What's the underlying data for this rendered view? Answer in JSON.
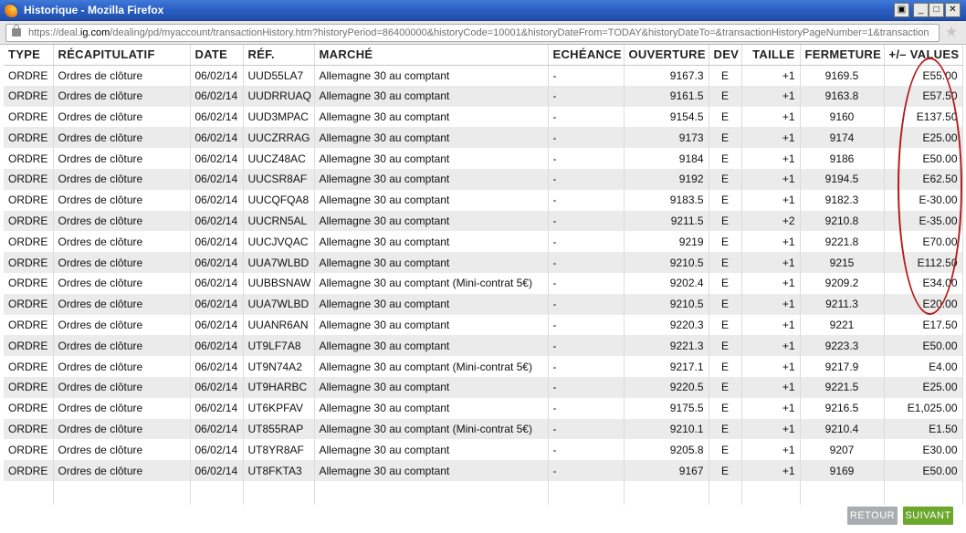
{
  "window": {
    "title": "Historique - Mozilla Firefox",
    "url_host_prefix": "https://deal.",
    "url_host_domain": "ig.com",
    "url_path": "/dealing/pd/myaccount/transactionHistory.htm?historyPeriod=86400000&historyCode=10001&historyDateFrom=TODAY&historyDateTo=&transactionHistoryPageNumber=1&transaction"
  },
  "table": {
    "headers": [
      "TYPE",
      "RÉCAPITULATIF",
      "DATE",
      "RÉF.",
      "MARCHÉ",
      "ECHÉANCE",
      "OUVERTURE",
      "DEV",
      "TAILLE",
      "FERMETURE",
      "+/– VALUES"
    ],
    "rows": [
      [
        "ORDRE",
        "Ordres de clôture",
        "06/02/14",
        "UUD55LA7",
        "Allemagne 30 au comptant",
        "-",
        "9167.3",
        "E",
        "+1",
        "9169.5",
        "E55.00"
      ],
      [
        "ORDRE",
        "Ordres de clôture",
        "06/02/14",
        "UUDRRUAQ",
        "Allemagne 30 au comptant",
        "-",
        "9161.5",
        "E",
        "+1",
        "9163.8",
        "E57.50"
      ],
      [
        "ORDRE",
        "Ordres de clôture",
        "06/02/14",
        "UUD3MPAC",
        "Allemagne 30 au comptant",
        "-",
        "9154.5",
        "E",
        "+1",
        "9160",
        "E137.50"
      ],
      [
        "ORDRE",
        "Ordres de clôture",
        "06/02/14",
        "UUCZRRAG",
        "Allemagne 30 au comptant",
        "-",
        "9173",
        "E",
        "+1",
        "9174",
        "E25.00"
      ],
      [
        "ORDRE",
        "Ordres de clôture",
        "06/02/14",
        "UUCZ48AC",
        "Allemagne 30 au comptant",
        "-",
        "9184",
        "E",
        "+1",
        "9186",
        "E50.00"
      ],
      [
        "ORDRE",
        "Ordres de clôture",
        "06/02/14",
        "UUCSR8AF",
        "Allemagne 30 au comptant",
        "-",
        "9192",
        "E",
        "+1",
        "9194.5",
        "E62.50"
      ],
      [
        "ORDRE",
        "Ordres de clôture",
        "06/02/14",
        "UUCQFQA8",
        "Allemagne 30 au comptant",
        "-",
        "9183.5",
        "E",
        "+1",
        "9182.3",
        "E-30.00"
      ],
      [
        "ORDRE",
        "Ordres de clôture",
        "06/02/14",
        "UUCRN5AL",
        "Allemagne 30 au comptant",
        "-",
        "9211.5",
        "E",
        "+2",
        "9210.8",
        "E-35.00"
      ],
      [
        "ORDRE",
        "Ordres de clôture",
        "06/02/14",
        "UUCJVQAC",
        "Allemagne 30 au comptant",
        "-",
        "9219",
        "E",
        "+1",
        "9221.8",
        "E70.00"
      ],
      [
        "ORDRE",
        "Ordres de clôture",
        "06/02/14",
        "UUA7WLBD",
        "Allemagne 30 au comptant",
        "-",
        "9210.5",
        "E",
        "+1",
        "9215",
        "E112.50"
      ],
      [
        "ORDRE",
        "Ordres de clôture",
        "06/02/14",
        "UUBBSNAW",
        "Allemagne 30 au comptant (Mini-contrat 5€)",
        "-",
        "9202.4",
        "E",
        "+1",
        "9209.2",
        "E34.00"
      ],
      [
        "ORDRE",
        "Ordres de clôture",
        "06/02/14",
        "UUA7WLBD",
        "Allemagne 30 au comptant",
        "-",
        "9210.5",
        "E",
        "+1",
        "9211.3",
        "E20.00"
      ],
      [
        "ORDRE",
        "Ordres de clôture",
        "06/02/14",
        "UUANR6AN",
        "Allemagne 30 au comptant",
        "-",
        "9220.3",
        "E",
        "+1",
        "9221",
        "E17.50"
      ],
      [
        "ORDRE",
        "Ordres de clôture",
        "06/02/14",
        "UT9LF7A8",
        "Allemagne 30 au comptant",
        "-",
        "9221.3",
        "E",
        "+1",
        "9223.3",
        "E50.00"
      ],
      [
        "ORDRE",
        "Ordres de clôture",
        "06/02/14",
        "UT9N74A2",
        "Allemagne 30 au comptant (Mini-contrat 5€)",
        "-",
        "9217.1",
        "E",
        "+1",
        "9217.9",
        "E4.00"
      ],
      [
        "ORDRE",
        "Ordres de clôture",
        "06/02/14",
        "UT9HARBC",
        "Allemagne 30 au comptant",
        "-",
        "9220.5",
        "E",
        "+1",
        "9221.5",
        "E25.00"
      ],
      [
        "ORDRE",
        "Ordres de clôture",
        "06/02/14",
        "UT6KPFAV",
        "Allemagne 30 au comptant",
        "-",
        "9175.5",
        "E",
        "+1",
        "9216.5",
        "E1,025.00"
      ],
      [
        "ORDRE",
        "Ordres de clôture",
        "06/02/14",
        "UT855RAP",
        "Allemagne 30 au comptant (Mini-contrat 5€)",
        "-",
        "9210.1",
        "E",
        "+1",
        "9210.4",
        "E1.50"
      ],
      [
        "ORDRE",
        "Ordres de clôture",
        "06/02/14",
        "UT8YR8AF",
        "Allemagne 30 au comptant",
        "-",
        "9205.8",
        "E",
        "+1",
        "9207",
        "E30.00"
      ],
      [
        "ORDRE",
        "Ordres de clôture",
        "06/02/14",
        "UT8FKTA3",
        "Allemagne 30 au comptant",
        "-",
        "9167",
        "E",
        "+1",
        "9169",
        "E50.00"
      ]
    ]
  },
  "buttons": {
    "retour": "RETOUR",
    "suivant": "SUIVANT"
  },
  "colors": {
    "titlebar": "#2c60c4",
    "annotation": "#b31b1b",
    "suivant": "#6aa72a",
    "retour": "#a9adb0"
  }
}
